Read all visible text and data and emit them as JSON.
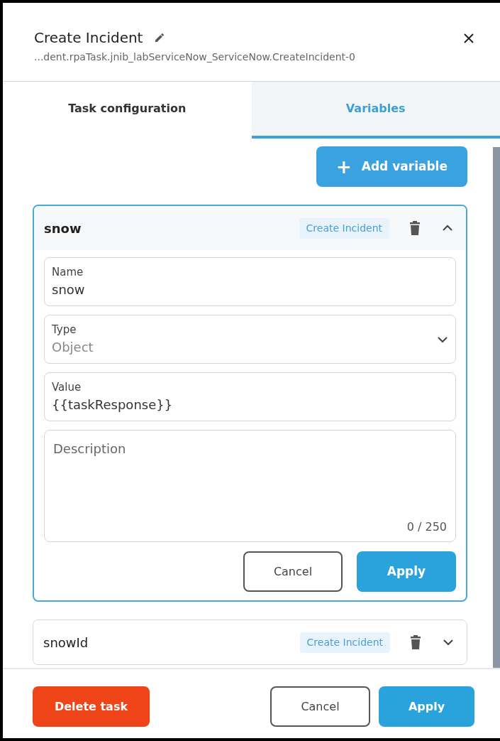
{
  "panel": {
    "title": "Create Incident",
    "subtitle": "...dent.rpaTask.jnib_labServiceNow_ServiceNow.CreateIncident-0"
  },
  "tabs": [
    {
      "label": "Task configuration",
      "selected": false
    },
    {
      "label": "Variables",
      "selected": true
    }
  ],
  "add_button": {
    "icon": "+",
    "label": "Add variable"
  },
  "variables": [
    {
      "name": "snow",
      "tag": "Create Incident",
      "expanded": true,
      "fields": [
        {
          "kind": "text",
          "label": "Name",
          "value": "snow"
        },
        {
          "kind": "select",
          "label": "Type",
          "value": "Object"
        },
        {
          "kind": "text",
          "label": "Value",
          "value": "{{taskResponse}}"
        },
        {
          "kind": "textarea",
          "placeholder": "Description",
          "counter": "0 / 250"
        }
      ],
      "buttons": [
        "Cancel",
        "Apply"
      ]
    },
    {
      "name": "snowId",
      "tag": "Create Incident",
      "expanded": false
    }
  ],
  "footer": {
    "delete": "Delete task",
    "cancel": "Cancel",
    "apply": "Apply"
  }
}
